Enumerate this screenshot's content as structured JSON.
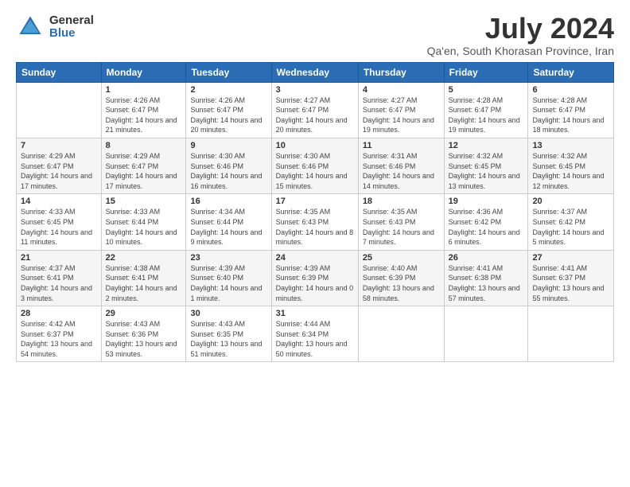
{
  "logo": {
    "general": "General",
    "blue": "Blue"
  },
  "title": "July 2024",
  "subtitle": "Qa'en, South Khorasan Province, Iran",
  "days_header": [
    "Sunday",
    "Monday",
    "Tuesday",
    "Wednesday",
    "Thursday",
    "Friday",
    "Saturday"
  ],
  "weeks": [
    [
      {
        "day": "",
        "sunrise": "",
        "sunset": "",
        "daylight": ""
      },
      {
        "day": "1",
        "sunrise": "Sunrise: 4:26 AM",
        "sunset": "Sunset: 6:47 PM",
        "daylight": "Daylight: 14 hours and 21 minutes."
      },
      {
        "day": "2",
        "sunrise": "Sunrise: 4:26 AM",
        "sunset": "Sunset: 6:47 PM",
        "daylight": "Daylight: 14 hours and 20 minutes."
      },
      {
        "day": "3",
        "sunrise": "Sunrise: 4:27 AM",
        "sunset": "Sunset: 6:47 PM",
        "daylight": "Daylight: 14 hours and 20 minutes."
      },
      {
        "day": "4",
        "sunrise": "Sunrise: 4:27 AM",
        "sunset": "Sunset: 6:47 PM",
        "daylight": "Daylight: 14 hours and 19 minutes."
      },
      {
        "day": "5",
        "sunrise": "Sunrise: 4:28 AM",
        "sunset": "Sunset: 6:47 PM",
        "daylight": "Daylight: 14 hours and 19 minutes."
      },
      {
        "day": "6",
        "sunrise": "Sunrise: 4:28 AM",
        "sunset": "Sunset: 6:47 PM",
        "daylight": "Daylight: 14 hours and 18 minutes."
      }
    ],
    [
      {
        "day": "7",
        "sunrise": "Sunrise: 4:29 AM",
        "sunset": "Sunset: 6:47 PM",
        "daylight": "Daylight: 14 hours and 17 minutes."
      },
      {
        "day": "8",
        "sunrise": "Sunrise: 4:29 AM",
        "sunset": "Sunset: 6:47 PM",
        "daylight": "Daylight: 14 hours and 17 minutes."
      },
      {
        "day": "9",
        "sunrise": "Sunrise: 4:30 AM",
        "sunset": "Sunset: 6:46 PM",
        "daylight": "Daylight: 14 hours and 16 minutes."
      },
      {
        "day": "10",
        "sunrise": "Sunrise: 4:30 AM",
        "sunset": "Sunset: 6:46 PM",
        "daylight": "Daylight: 14 hours and 15 minutes."
      },
      {
        "day": "11",
        "sunrise": "Sunrise: 4:31 AM",
        "sunset": "Sunset: 6:46 PM",
        "daylight": "Daylight: 14 hours and 14 minutes."
      },
      {
        "day": "12",
        "sunrise": "Sunrise: 4:32 AM",
        "sunset": "Sunset: 6:45 PM",
        "daylight": "Daylight: 14 hours and 13 minutes."
      },
      {
        "day": "13",
        "sunrise": "Sunrise: 4:32 AM",
        "sunset": "Sunset: 6:45 PM",
        "daylight": "Daylight: 14 hours and 12 minutes."
      }
    ],
    [
      {
        "day": "14",
        "sunrise": "Sunrise: 4:33 AM",
        "sunset": "Sunset: 6:45 PM",
        "daylight": "Daylight: 14 hours and 11 minutes."
      },
      {
        "day": "15",
        "sunrise": "Sunrise: 4:33 AM",
        "sunset": "Sunset: 6:44 PM",
        "daylight": "Daylight: 14 hours and 10 minutes."
      },
      {
        "day": "16",
        "sunrise": "Sunrise: 4:34 AM",
        "sunset": "Sunset: 6:44 PM",
        "daylight": "Daylight: 14 hours and 9 minutes."
      },
      {
        "day": "17",
        "sunrise": "Sunrise: 4:35 AM",
        "sunset": "Sunset: 6:43 PM",
        "daylight": "Daylight: 14 hours and 8 minutes."
      },
      {
        "day": "18",
        "sunrise": "Sunrise: 4:35 AM",
        "sunset": "Sunset: 6:43 PM",
        "daylight": "Daylight: 14 hours and 7 minutes."
      },
      {
        "day": "19",
        "sunrise": "Sunrise: 4:36 AM",
        "sunset": "Sunset: 6:42 PM",
        "daylight": "Daylight: 14 hours and 6 minutes."
      },
      {
        "day": "20",
        "sunrise": "Sunrise: 4:37 AM",
        "sunset": "Sunset: 6:42 PM",
        "daylight": "Daylight: 14 hours and 5 minutes."
      }
    ],
    [
      {
        "day": "21",
        "sunrise": "Sunrise: 4:37 AM",
        "sunset": "Sunset: 6:41 PM",
        "daylight": "Daylight: 14 hours and 3 minutes."
      },
      {
        "day": "22",
        "sunrise": "Sunrise: 4:38 AM",
        "sunset": "Sunset: 6:41 PM",
        "daylight": "Daylight: 14 hours and 2 minutes."
      },
      {
        "day": "23",
        "sunrise": "Sunrise: 4:39 AM",
        "sunset": "Sunset: 6:40 PM",
        "daylight": "Daylight: 14 hours and 1 minute."
      },
      {
        "day": "24",
        "sunrise": "Sunrise: 4:39 AM",
        "sunset": "Sunset: 6:39 PM",
        "daylight": "Daylight: 14 hours and 0 minutes."
      },
      {
        "day": "25",
        "sunrise": "Sunrise: 4:40 AM",
        "sunset": "Sunset: 6:39 PM",
        "daylight": "Daylight: 13 hours and 58 minutes."
      },
      {
        "day": "26",
        "sunrise": "Sunrise: 4:41 AM",
        "sunset": "Sunset: 6:38 PM",
        "daylight": "Daylight: 13 hours and 57 minutes."
      },
      {
        "day": "27",
        "sunrise": "Sunrise: 4:41 AM",
        "sunset": "Sunset: 6:37 PM",
        "daylight": "Daylight: 13 hours and 55 minutes."
      }
    ],
    [
      {
        "day": "28",
        "sunrise": "Sunrise: 4:42 AM",
        "sunset": "Sunset: 6:37 PM",
        "daylight": "Daylight: 13 hours and 54 minutes."
      },
      {
        "day": "29",
        "sunrise": "Sunrise: 4:43 AM",
        "sunset": "Sunset: 6:36 PM",
        "daylight": "Daylight: 13 hours and 53 minutes."
      },
      {
        "day": "30",
        "sunrise": "Sunrise: 4:43 AM",
        "sunset": "Sunset: 6:35 PM",
        "daylight": "Daylight: 13 hours and 51 minutes."
      },
      {
        "day": "31",
        "sunrise": "Sunrise: 4:44 AM",
        "sunset": "Sunset: 6:34 PM",
        "daylight": "Daylight: 13 hours and 50 minutes."
      },
      {
        "day": "",
        "sunrise": "",
        "sunset": "",
        "daylight": ""
      },
      {
        "day": "",
        "sunrise": "",
        "sunset": "",
        "daylight": ""
      },
      {
        "day": "",
        "sunrise": "",
        "sunset": "",
        "daylight": ""
      }
    ]
  ]
}
